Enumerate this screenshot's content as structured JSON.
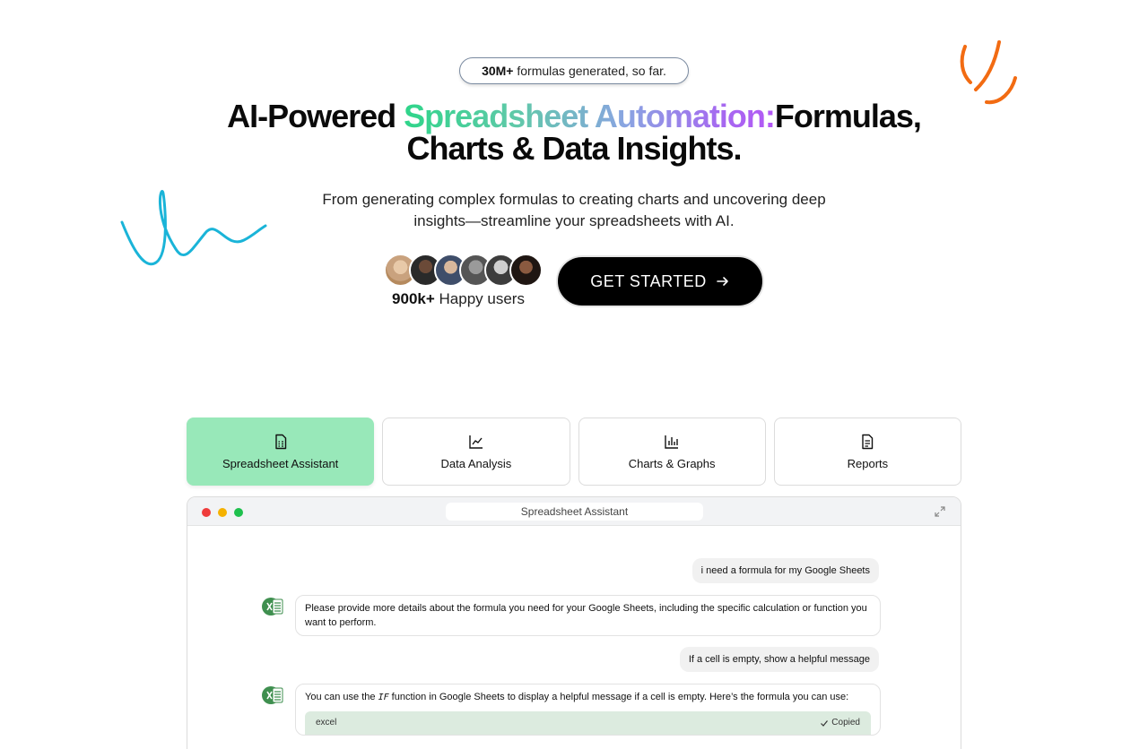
{
  "hero": {
    "badge_count": "30M+",
    "badge_text": " formulas generated, so far.",
    "title_part1": "AI-Powered ",
    "title_gradient": "Spreadsheet Automation:",
    "title_part2": "Formulas,",
    "title_line2": "Charts & Data Insights.",
    "subtitle": "From generating complex formulas to creating charts and uncovering deep insights—streamline your spreadsheets with AI.",
    "users_count": "900k+",
    "users_text": " Happy users",
    "cta_label": "GET STARTED",
    "avatar_colors": [
      "#c9a27e",
      "#3b3b3b",
      "#8a6a55",
      "#777777",
      "#5a5a5a",
      "#2a1d18"
    ]
  },
  "tabs": [
    {
      "label": "Spreadsheet Assistant",
      "icon": "spreadsheet-icon",
      "active": true
    },
    {
      "label": "Data Analysis",
      "icon": "line-chart-icon",
      "active": false
    },
    {
      "label": "Charts & Graphs",
      "icon": "bar-chart-icon",
      "active": false
    },
    {
      "label": "Reports",
      "icon": "document-icon",
      "active": false
    }
  ],
  "window": {
    "title": "Spreadsheet Assistant"
  },
  "chat": {
    "user_msg_1": "i need a formula for my Google Sheets",
    "bot_msg_1": "Please provide more details about the formula you need for your Google Sheets, including the specific calculation or function you want to perform.",
    "user_msg_2": "If a cell is empty, show a helpful message",
    "bot_msg_2_prefix": "You can use the ",
    "bot_msg_2_code": "IF",
    "bot_msg_2_suffix": " function in Google Sheets to display a helpful message if a cell is empty. Here’s the formula you can use:",
    "code_lang": "excel",
    "copied_label": "Copied"
  },
  "colors": {
    "accent_tab": "#98e8b9",
    "doodle_blue": "#1ab4d8",
    "doodle_orange": "#f26b12"
  }
}
